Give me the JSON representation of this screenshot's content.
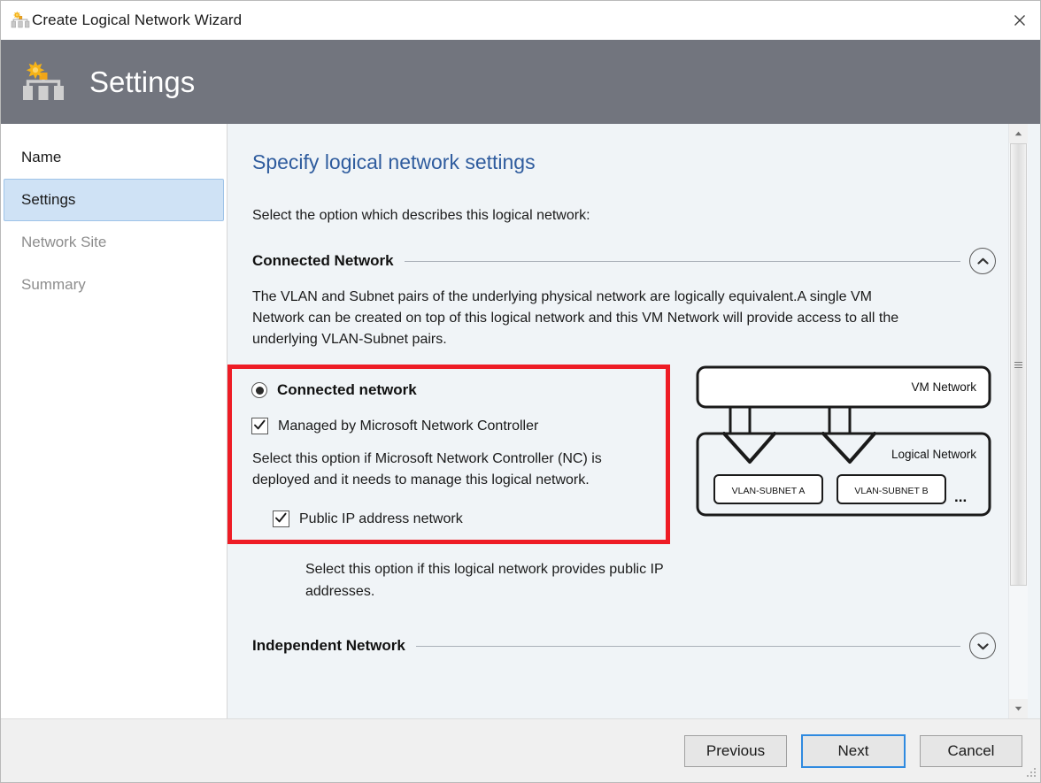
{
  "window": {
    "title": "Create Logical Network Wizard",
    "close_label": "×",
    "icon": "logical-network-wizard-icon"
  },
  "header": {
    "title": "Settings",
    "icon": "logical-network-wizard-icon"
  },
  "sidebar": {
    "items": [
      {
        "label": "Name",
        "state": "enabled"
      },
      {
        "label": "Settings",
        "state": "selected"
      },
      {
        "label": "Network Site",
        "state": "disabled"
      },
      {
        "label": "Summary",
        "state": "disabled"
      }
    ]
  },
  "main": {
    "page_title": "Specify logical network settings",
    "intro": "Select the option which describes this logical network:",
    "sections": [
      {
        "label": "Connected Network",
        "expanded": true,
        "toggle_icon": "chevron-up-icon",
        "description": "The VLAN and Subnet pairs of the underlying physical network are logically equivalent.A single VM Network can be created on top of this logical network and this VM Network will provide access to all the underlying VLAN-Subnet pairs.",
        "radio": {
          "label": "Connected network",
          "checked": true
        },
        "checkbox_nc": {
          "label": "Managed by Microsoft Network Controller",
          "checked": true
        },
        "hint_nc": "Select this option if Microsoft Network Controller (NC) is deployed and it needs to manage this logical network.",
        "checkbox_public": {
          "label": "Public IP address network",
          "checked": true
        },
        "hint_public": "Select this option if this logical network provides public IP addresses."
      },
      {
        "label": "Independent Network",
        "expanded": false,
        "toggle_icon": "chevron-down-icon"
      }
    ]
  },
  "diagram": {
    "vm_network_label": "VM Network",
    "logical_network_label": "Logical  Network",
    "subnets": [
      "VLAN-SUBNET A",
      "VLAN-SUBNET B"
    ],
    "ellipsis": "..."
  },
  "scrollbar": {
    "up_icon": "triangle-up-icon",
    "down_icon": "triangle-down-icon"
  },
  "footer": {
    "buttons": [
      {
        "label": "Previous",
        "focused": false
      },
      {
        "label": "Next",
        "focused": true
      },
      {
        "label": "Cancel",
        "focused": false
      }
    ]
  },
  "colors": {
    "header_band": "#72757e",
    "content_bg": "#f0f4f7",
    "accent_title": "#2f5c9e",
    "highlight_red": "#ee1c25",
    "selection_blue": "#cfe2f5",
    "focus_blue": "#2f8ae0"
  }
}
